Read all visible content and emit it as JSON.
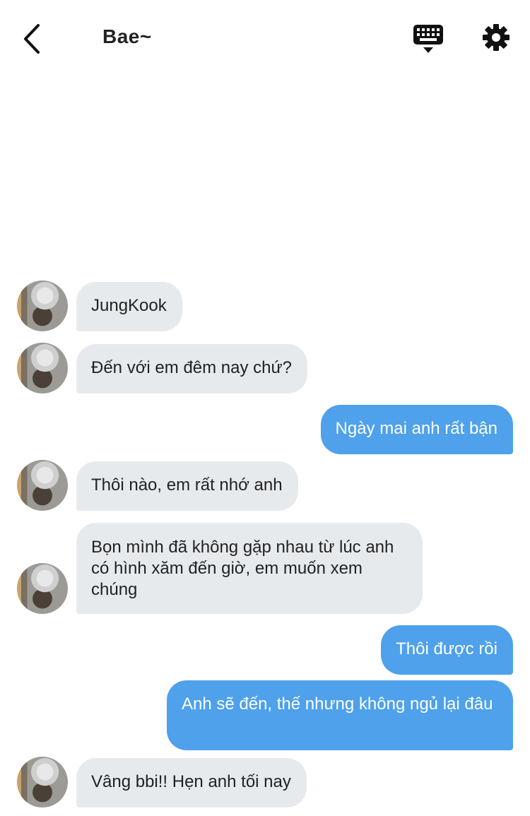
{
  "header": {
    "title": "Bae~",
    "back_icon": "chevron-left-icon",
    "keyboard_icon": "keyboard-icon",
    "settings_icon": "gear-icon"
  },
  "colors": {
    "incoming_bubble": "#e7eaed",
    "outgoing_bubble": "#4ea1ea",
    "text_dark": "#222222"
  },
  "messages": [
    {
      "dir": "in",
      "text": "JungKook"
    },
    {
      "dir": "in",
      "text": "Đến với em đêm nay chứ?"
    },
    {
      "dir": "out",
      "text": "Ngày mai anh rất bận"
    },
    {
      "dir": "in",
      "text": "Thôi nào, em rất nhớ anh"
    },
    {
      "dir": "in",
      "text": "Bọn mình đã không gặp nhau từ lúc anh có hình xăm đến giờ, em muốn xem chúng"
    },
    {
      "dir": "out",
      "text": "Thôi được rồi"
    },
    {
      "dir": "out",
      "text": "Anh sẽ đến, thế nhưng không ngủ lại đâu"
    },
    {
      "dir": "in",
      "text": "Vâng bbi!! Hẹn anh tối nay"
    }
  ]
}
